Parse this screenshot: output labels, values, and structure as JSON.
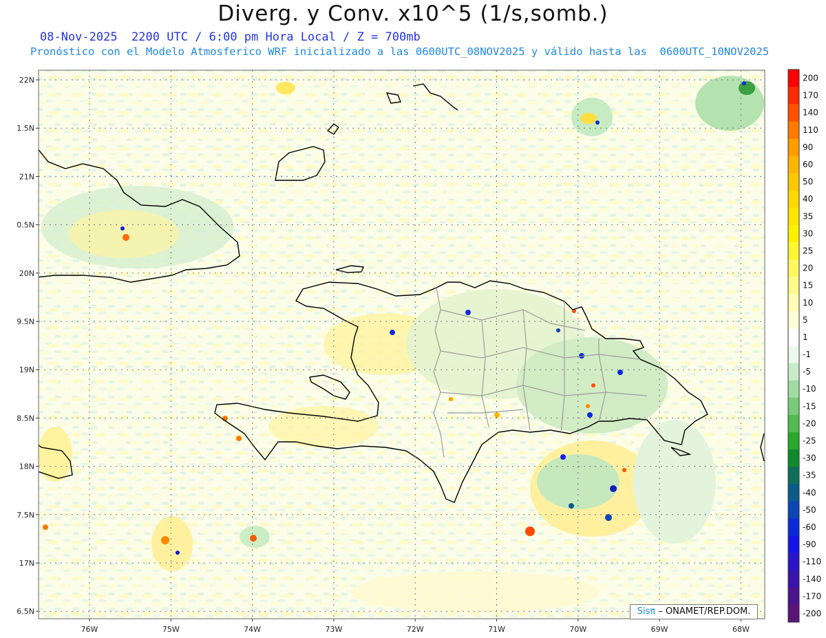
{
  "header": {
    "title": "Diverg. y Conv. x10^5 (1/s,somb.)",
    "subtitle": "08-Nov-2025  2200 UTC / 6:00 pm Hora Local / Z = 700mb",
    "forecast": "Pronóstico con el Modelo Atmosferico WRF inicializado a las 0600UTC_08NOV2025 y válido hasta las  0600UTC_10NOV2025"
  },
  "map": {
    "lat_labels": [
      "22N",
      "1.5N",
      "21N",
      "0.5N",
      "20N",
      "9.5N",
      "19N",
      "8.5N",
      "18N",
      "7.5N",
      "17N",
      "6.5N"
    ],
    "lon_labels": [
      "76W",
      "75W",
      "74W",
      "73W",
      "72W",
      "71W",
      "70W",
      "69W",
      "68W"
    ],
    "colors": {
      "coastline": "#000000",
      "borders": "#9e9e9e",
      "grid": "#777777"
    }
  },
  "colorbar": {
    "labels": [
      "200",
      "170",
      "140",
      "110",
      "90",
      "60",
      "50",
      "40",
      "35",
      "30",
      "25",
      "20",
      "15",
      "10",
      "5",
      "1",
      "-1",
      "-5",
      "-10",
      "-15",
      "-20",
      "-25",
      "-30",
      "-35",
      "-40",
      "-50",
      "-60",
      "-90",
      "-110",
      "-140",
      "-170",
      "-200"
    ],
    "colors": [
      "#ff0000",
      "#ff2a00",
      "#ff5000",
      "#ff7a00",
      "#ff9c00",
      "#ffb400",
      "#ffc800",
      "#ffd800",
      "#ffe600",
      "#fff000",
      "#fff530",
      "#fff860",
      "#fffa8c",
      "#fffcb4",
      "#fffed6",
      "#ffffff",
      "#ebf8eb",
      "#c8ecc8",
      "#a0dca0",
      "#78cc78",
      "#50bc50",
      "#2aa82a",
      "#0e8a2a",
      "#0e6e5a",
      "#0a5a8a",
      "#0a46b4",
      "#0a2ad8",
      "#1414e6",
      "#2a14c8",
      "#3a14a8",
      "#4a148c",
      "#5a1478"
    ]
  },
  "credit": {
    "brand": "Sisπ",
    "org": "ONAMET/REP.DOM."
  }
}
